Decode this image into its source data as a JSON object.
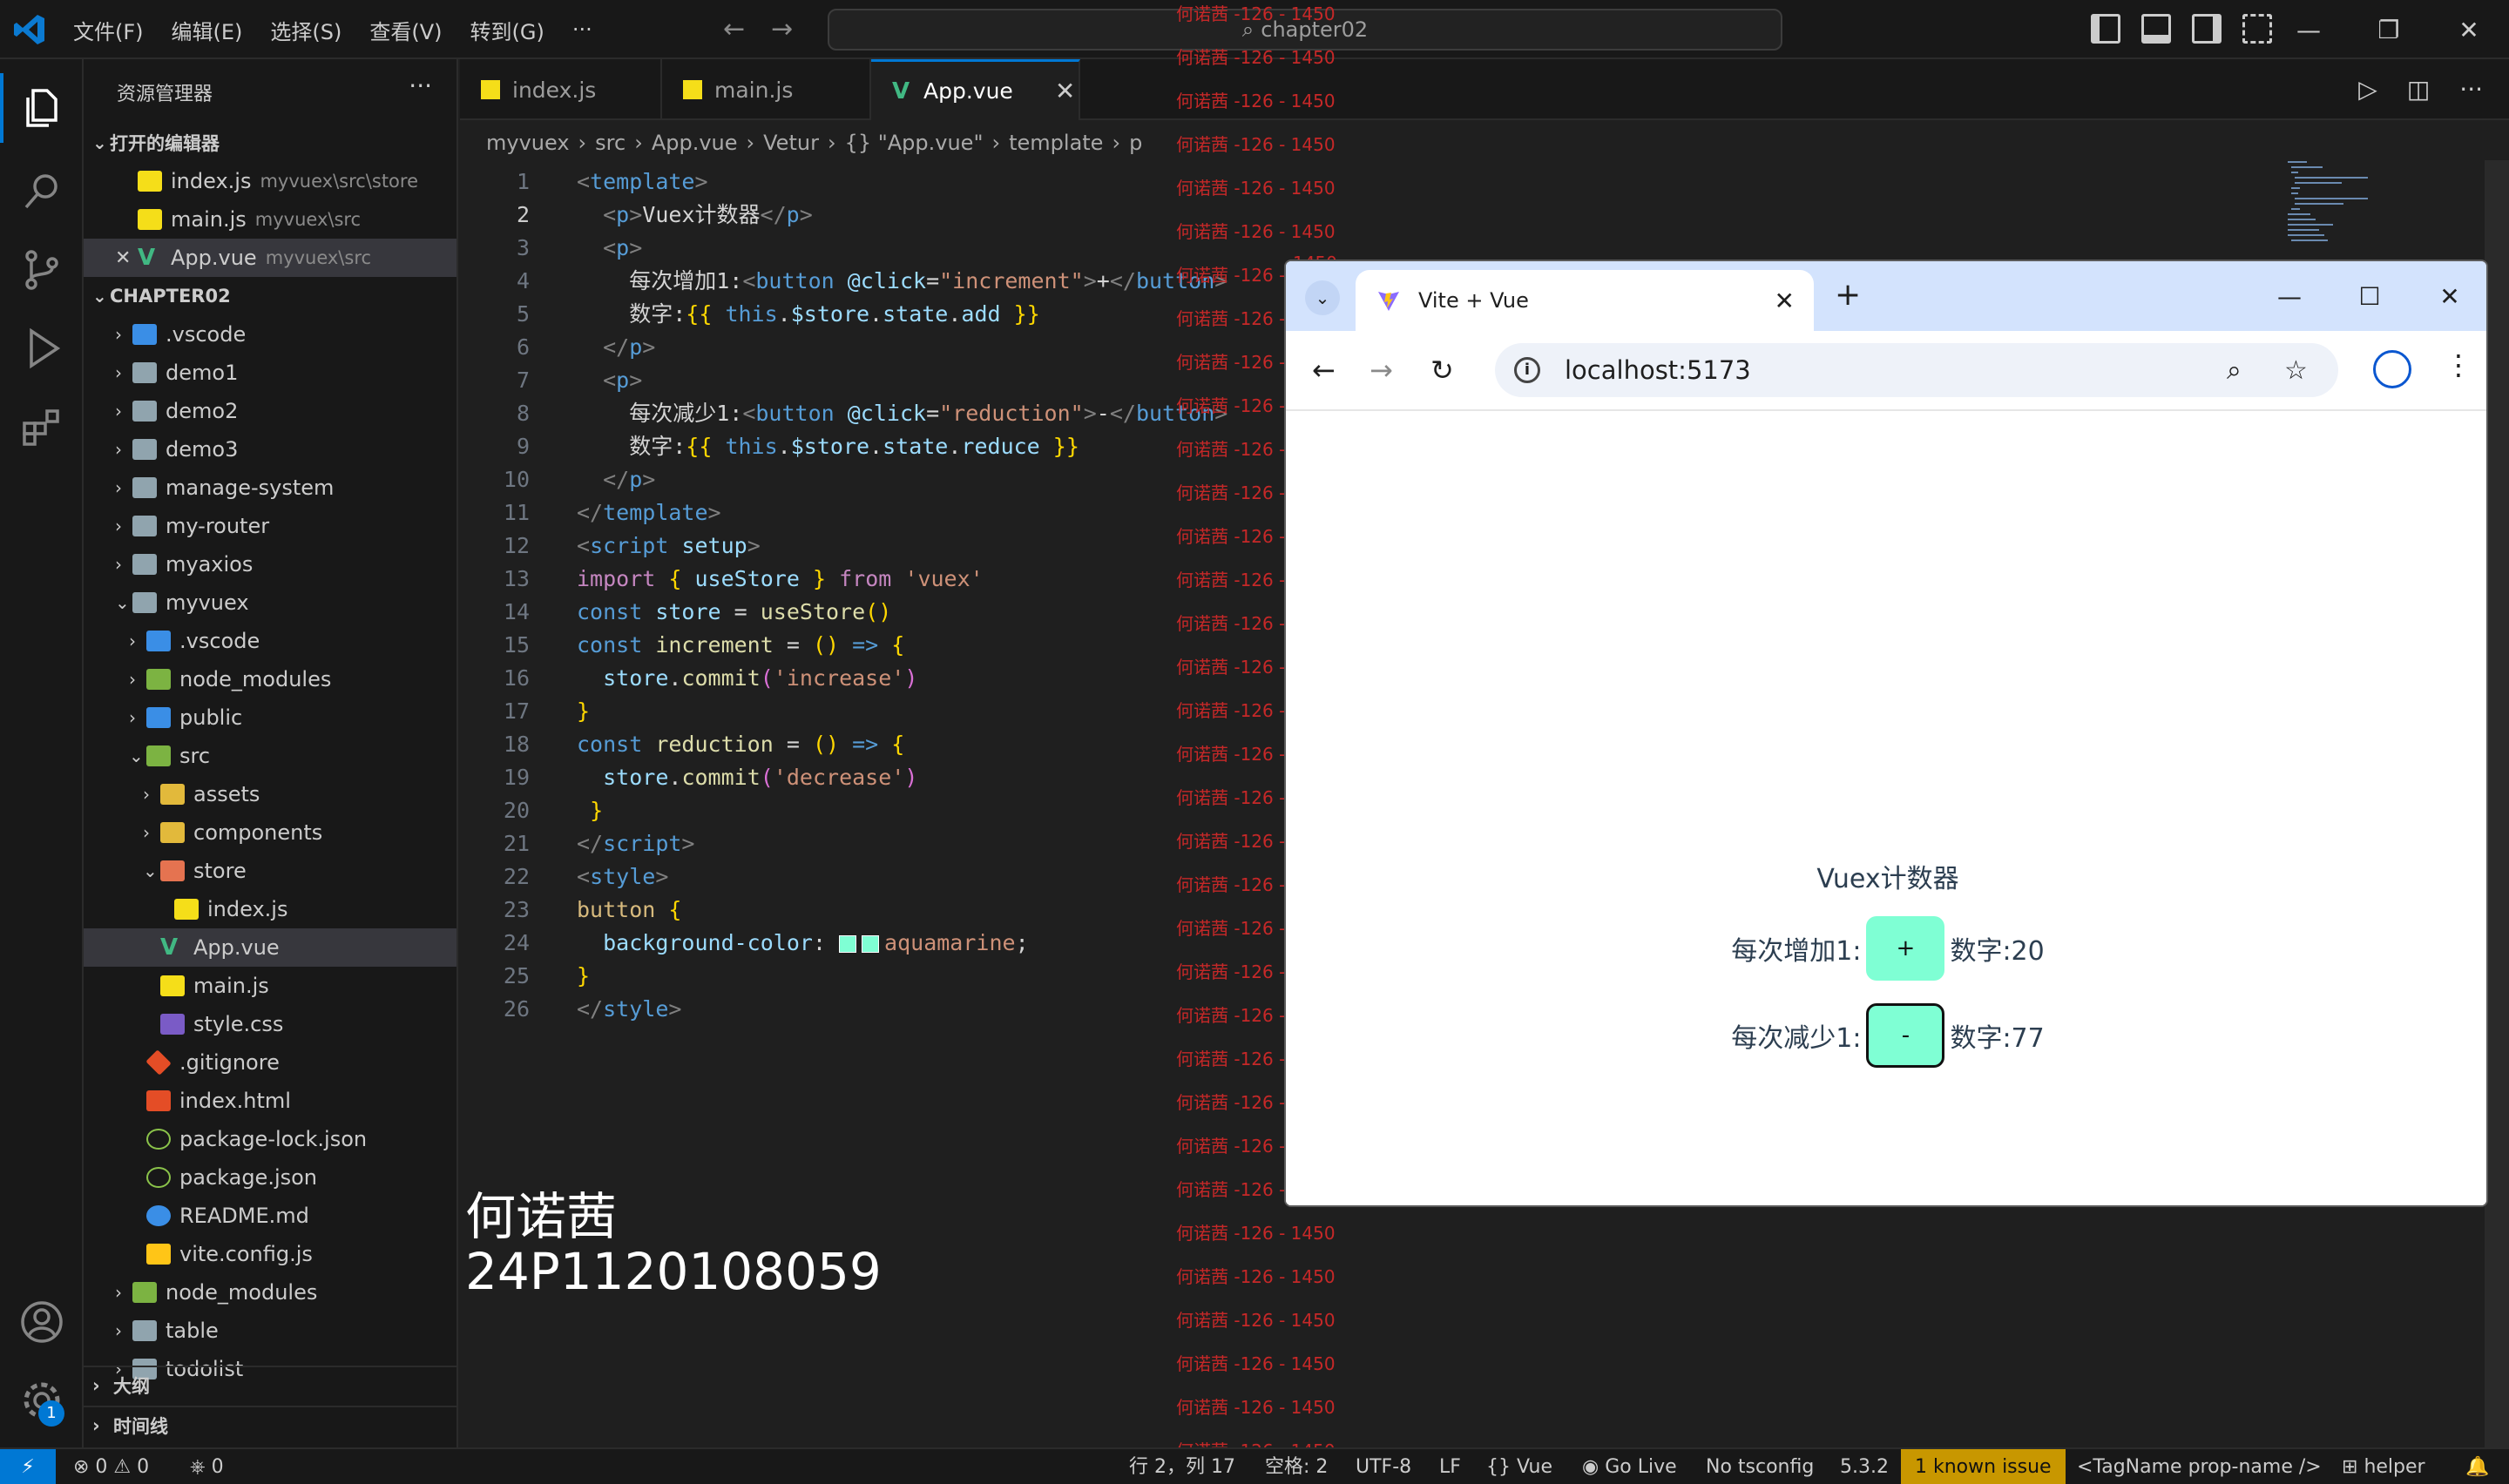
{
  "titlebar": {
    "menu": [
      "文件(F)",
      "编辑(E)",
      "选择(S)",
      "查看(V)",
      "转到(G)",
      "···"
    ],
    "search_text": "chapter02"
  },
  "sidebar": {
    "title": "资源管理器",
    "more": "···",
    "open_editors_label": "打开的编辑器",
    "open_editors": [
      {
        "name": "index.js",
        "desc": "myvuex\\src\\store",
        "icon": "js"
      },
      {
        "name": "main.js",
        "desc": "myvuex\\src",
        "icon": "js"
      },
      {
        "name": "App.vue",
        "desc": "myvuex\\src",
        "icon": "vue",
        "selected": true
      }
    ],
    "workspace_label": "CHAPTER02",
    "tree": [
      {
        "name": ".vscode",
        "indent": 1,
        "chev": "›",
        "icon": "folder-blue"
      },
      {
        "name": "demo1",
        "indent": 1,
        "chev": "›",
        "icon": "folder-gray"
      },
      {
        "name": "demo2",
        "indent": 1,
        "chev": "›",
        "icon": "folder-gray"
      },
      {
        "name": "demo3",
        "indent": 1,
        "chev": "›",
        "icon": "folder-gray"
      },
      {
        "name": "manage-system",
        "indent": 1,
        "chev": "›",
        "icon": "folder-gray"
      },
      {
        "name": "my-router",
        "indent": 1,
        "chev": "›",
        "icon": "folder-gray"
      },
      {
        "name": "myaxios",
        "indent": 1,
        "chev": "›",
        "icon": "folder-gray"
      },
      {
        "name": "myvuex",
        "indent": 1,
        "chev": "⌄",
        "icon": "folder-gray"
      },
      {
        "name": ".vscode",
        "indent": 2,
        "chev": "›",
        "icon": "folder-blue"
      },
      {
        "name": "node_modules",
        "indent": 2,
        "chev": "›",
        "icon": "folder-green"
      },
      {
        "name": "public",
        "indent": 2,
        "chev": "›",
        "icon": "folder-blue"
      },
      {
        "name": "src",
        "indent": 2,
        "chev": "⌄",
        "icon": "folder-green"
      },
      {
        "name": "assets",
        "indent": 3,
        "chev": "›",
        "icon": "folder-yellow"
      },
      {
        "name": "components",
        "indent": 3,
        "chev": "›",
        "icon": "folder-yellow"
      },
      {
        "name": "store",
        "indent": 3,
        "chev": "⌄",
        "icon": "folder-red"
      },
      {
        "name": "index.js",
        "indent": 4,
        "chev": "",
        "icon": "js"
      },
      {
        "name": "App.vue",
        "indent": 3,
        "chev": "",
        "icon": "vue",
        "selected": true
      },
      {
        "name": "main.js",
        "indent": 3,
        "chev": "",
        "icon": "js"
      },
      {
        "name": "style.css",
        "indent": 3,
        "chev": "",
        "icon": "css"
      },
      {
        "name": ".gitignore",
        "indent": 2,
        "chev": "",
        "icon": "git"
      },
      {
        "name": "index.html",
        "indent": 2,
        "chev": "",
        "icon": "html"
      },
      {
        "name": "package-lock.json",
        "indent": 2,
        "chev": "",
        "icon": "json"
      },
      {
        "name": "package.json",
        "indent": 2,
        "chev": "",
        "icon": "json"
      },
      {
        "name": "README.md",
        "indent": 2,
        "chev": "",
        "icon": "info"
      },
      {
        "name": "vite.config.js",
        "indent": 2,
        "chev": "",
        "icon": "vite"
      },
      {
        "name": "node_modules",
        "indent": 1,
        "chev": "›",
        "icon": "folder-green"
      },
      {
        "name": "table",
        "indent": 1,
        "chev": "›",
        "icon": "folder-gray"
      },
      {
        "name": "todolist",
        "indent": 1,
        "chev": "›",
        "icon": "folder-gray"
      }
    ],
    "outline_label": "大纲",
    "timeline_label": "时间线"
  },
  "tabs": [
    {
      "label": "index.js",
      "icon": "js"
    },
    {
      "label": "main.js",
      "icon": "js"
    },
    {
      "label": "App.vue",
      "icon": "vue",
      "active": true
    }
  ],
  "breadcrumb": [
    "myvuex",
    "src",
    "App.vue",
    "Vetur",
    "{} \"App.vue\"",
    "template",
    "p"
  ],
  "code_lines": [
    [
      [
        "t-tag",
        "<"
      ],
      [
        "t-name",
        "template"
      ],
      [
        "t-tag",
        ">"
      ]
    ],
    [
      [
        "t-txt",
        "  "
      ],
      [
        "t-tag",
        "<"
      ],
      [
        "t-name",
        "p"
      ],
      [
        "t-tag",
        ">"
      ],
      [
        "t-txt",
        "Vuex计数器"
      ],
      [
        "t-tag",
        "</"
      ],
      [
        "t-name",
        "p"
      ],
      [
        "t-tag",
        ">"
      ]
    ],
    [
      [
        "t-txt",
        "  "
      ],
      [
        "t-tag",
        "<"
      ],
      [
        "t-name",
        "p"
      ],
      [
        "t-tag",
        ">"
      ]
    ],
    [
      [
        "t-txt",
        "    每次增加1:"
      ],
      [
        "t-tag",
        "<"
      ],
      [
        "t-name",
        "button"
      ],
      [
        "t-txt",
        " "
      ],
      [
        "t-attr",
        "@click"
      ],
      [
        "t-txt",
        "="
      ],
      [
        "t-str",
        "\"increment\""
      ],
      [
        "t-tag",
        ">"
      ],
      [
        "t-txt",
        "+"
      ],
      [
        "t-tag",
        "</"
      ],
      [
        "t-name",
        "button"
      ],
      [
        "t-tag",
        ">"
      ]
    ],
    [
      [
        "t-txt",
        "    数字:"
      ],
      [
        "t-brk",
        "{{"
      ],
      [
        "t-txt",
        " "
      ],
      [
        "t-kw",
        "this"
      ],
      [
        "t-txt",
        "."
      ],
      [
        "t-var",
        "$store"
      ],
      [
        "t-txt",
        "."
      ],
      [
        "t-var",
        "state"
      ],
      [
        "t-txt",
        "."
      ],
      [
        "t-var",
        "add"
      ],
      [
        "t-txt",
        " "
      ],
      [
        "t-brk",
        "}}"
      ]
    ],
    [
      [
        "t-txt",
        "  "
      ],
      [
        "t-tag",
        "</"
      ],
      [
        "t-name",
        "p"
      ],
      [
        "t-tag",
        ">"
      ]
    ],
    [
      [
        "t-txt",
        "  "
      ],
      [
        "t-tag",
        "<"
      ],
      [
        "t-name",
        "p"
      ],
      [
        "t-tag",
        ">"
      ]
    ],
    [
      [
        "t-txt",
        "    每次减少1:"
      ],
      [
        "t-tag",
        "<"
      ],
      [
        "t-name",
        "button"
      ],
      [
        "t-txt",
        " "
      ],
      [
        "t-attr",
        "@click"
      ],
      [
        "t-txt",
        "="
      ],
      [
        "t-str",
        "\"reduction\""
      ],
      [
        "t-tag",
        ">"
      ],
      [
        "t-txt",
        "-"
      ],
      [
        "t-tag",
        "</"
      ],
      [
        "t-name",
        "button"
      ],
      [
        "t-tag",
        ">"
      ]
    ],
    [
      [
        "t-txt",
        "    数字:"
      ],
      [
        "t-brk",
        "{{"
      ],
      [
        "t-txt",
        " "
      ],
      [
        "t-kw",
        "this"
      ],
      [
        "t-txt",
        "."
      ],
      [
        "t-var",
        "$store"
      ],
      [
        "t-txt",
        "."
      ],
      [
        "t-var",
        "state"
      ],
      [
        "t-txt",
        "."
      ],
      [
        "t-var",
        "reduce"
      ],
      [
        "t-txt",
        " "
      ],
      [
        "t-brk",
        "}}"
      ]
    ],
    [
      [
        "t-txt",
        "  "
      ],
      [
        "t-tag",
        "</"
      ],
      [
        "t-name",
        "p"
      ],
      [
        "t-tag",
        ">"
      ]
    ],
    [
      [
        "t-tag",
        "</"
      ],
      [
        "t-name",
        "template"
      ],
      [
        "t-tag",
        ">"
      ]
    ],
    [
      [
        "t-tag",
        "<"
      ],
      [
        "t-name",
        "script"
      ],
      [
        "t-txt",
        " "
      ],
      [
        "t-attr",
        "setup"
      ],
      [
        "t-tag",
        ">"
      ]
    ],
    [
      [
        "t-imp",
        "import"
      ],
      [
        "t-txt",
        " "
      ],
      [
        "t-brk",
        "{"
      ],
      [
        "t-txt",
        " "
      ],
      [
        "t-var",
        "useStore"
      ],
      [
        "t-txt",
        " "
      ],
      [
        "t-brk",
        "}"
      ],
      [
        "t-txt",
        " "
      ],
      [
        "t-imp",
        "from"
      ],
      [
        "t-txt",
        " "
      ],
      [
        "t-str",
        "'vuex'"
      ]
    ],
    [
      [
        "t-kw",
        "const"
      ],
      [
        "t-txt",
        " "
      ],
      [
        "t-var",
        "store"
      ],
      [
        "t-txt",
        " = "
      ],
      [
        "t-fn",
        "useStore"
      ],
      [
        "t-brk",
        "()"
      ]
    ],
    [
      [
        "t-kw",
        "const"
      ],
      [
        "t-txt",
        " "
      ],
      [
        "t-fn",
        "increment"
      ],
      [
        "t-txt",
        " = "
      ],
      [
        "t-brk",
        "()"
      ],
      [
        "t-txt",
        " "
      ],
      [
        "t-kw",
        "=>"
      ],
      [
        "t-txt",
        " "
      ],
      [
        "t-brk",
        "{"
      ]
    ],
    [
      [
        "t-txt",
        "  "
      ],
      [
        "t-var",
        "store"
      ],
      [
        "t-txt",
        "."
      ],
      [
        "t-fn",
        "commit"
      ],
      [
        "t-brk2",
        "("
      ],
      [
        "t-str",
        "'increase'"
      ],
      [
        "t-brk2",
        ")"
      ]
    ],
    [
      [
        "t-brk",
        "}"
      ]
    ],
    [
      [
        "t-kw",
        "const"
      ],
      [
        "t-txt",
        " "
      ],
      [
        "t-fn",
        "reduction"
      ],
      [
        "t-txt",
        " = "
      ],
      [
        "t-brk",
        "()"
      ],
      [
        "t-txt",
        " "
      ],
      [
        "t-kw",
        "=>"
      ],
      [
        "t-txt",
        " "
      ],
      [
        "t-brk",
        "{"
      ]
    ],
    [
      [
        "t-txt",
        "  "
      ],
      [
        "t-var",
        "store"
      ],
      [
        "t-txt",
        "."
      ],
      [
        "t-fn",
        "commit"
      ],
      [
        "t-brk2",
        "("
      ],
      [
        "t-str",
        "'decrease'"
      ],
      [
        "t-brk2",
        ")"
      ]
    ],
    [
      [
        "t-txt",
        " "
      ],
      [
        "t-brk",
        "}"
      ]
    ],
    [
      [
        "t-tag",
        "</"
      ],
      [
        "t-name",
        "script"
      ],
      [
        "t-tag",
        ">"
      ]
    ],
    [
      [
        "t-tag",
        "<"
      ],
      [
        "t-name",
        "style"
      ],
      [
        "t-tag",
        ">"
      ]
    ],
    [
      [
        "t-sel",
        "button"
      ],
      [
        "t-txt",
        " "
      ],
      [
        "t-brk",
        "{"
      ]
    ],
    [
      [
        "t-txt",
        "  "
      ],
      [
        "t-attr",
        "background-color"
      ],
      [
        "t-txt",
        ": "
      ],
      [
        "swatch",
        ""
      ],
      [
        "t-str",
        "aquamarine"
      ],
      [
        "t-txt",
        ";"
      ]
    ],
    [
      [
        "t-brk",
        "}"
      ]
    ],
    [
      [
        "t-tag",
        "</"
      ],
      [
        "t-name",
        "style"
      ],
      [
        "t-tag",
        ">"
      ]
    ]
  ],
  "current_line": 2,
  "watermark": {
    "name": "何诺茜",
    "student_id": "24P1120108059",
    "overlay_text": "何诺茜 -126 - 1450",
    "overlay_num": "1450"
  },
  "browser": {
    "tab_title": "Vite + Vue",
    "url": "localhost:5173",
    "page_title": "Vuex计数器",
    "increase_label": "每次增加1:",
    "increase_button": "+",
    "add_label": "数字:20",
    "decrease_label": "每次减少1:",
    "decrease_button": "-",
    "reduce_label": "数字:77",
    "accent": "#7fffd4"
  },
  "statusbar": {
    "remote": "⚡",
    "problems": "⊗ 0 ⚠ 0",
    "ports": "⎈ 0",
    "position": "行 2，列 17",
    "spaces": "空格: 2",
    "encoding": "UTF-8",
    "eol": "LF",
    "language": "{} Vue",
    "golive": "Go Live",
    "tsconfig": "No tsconfig",
    "version": "5.3.2",
    "issue": "1 known issue",
    "tag_hint": "<TagName prop-name />",
    "helper": "helper"
  }
}
